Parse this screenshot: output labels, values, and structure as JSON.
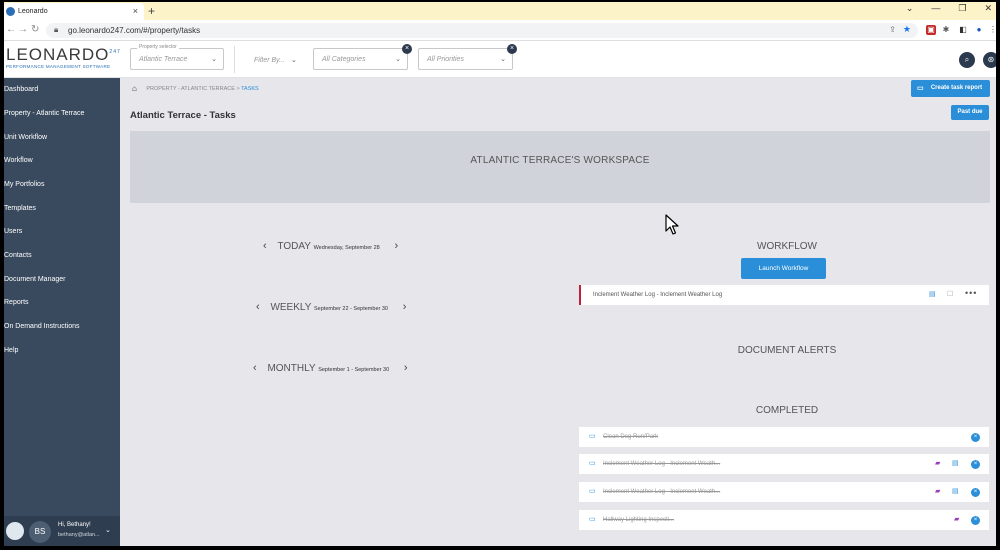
{
  "browser": {
    "tab_title": "Leonardo",
    "tab_close": "×",
    "new_tab": "+",
    "url": "go.leonardo247.com/#/property/tasks",
    "window_controls": [
      "⌄",
      "—",
      "❐",
      "✕"
    ]
  },
  "header": {
    "logo_text": "LEONARDO",
    "logo_badge": "247",
    "logo_tagline": "PERFORMANCE MANAGEMENT SOFTWARE",
    "property_selector_label": "Property selector",
    "property_selector_value": "Atlantic Terrace",
    "filter_by": "Filter By...",
    "categories_value": "All Categories",
    "priorities_value": "All Priorities"
  },
  "sidebar": {
    "items": [
      {
        "label": "Dashboard"
      },
      {
        "label": "Property - Atlantic Terrace"
      },
      {
        "label": "Unit Workflow"
      },
      {
        "label": "Workflow"
      },
      {
        "label": "My Portfolios"
      },
      {
        "label": "Templates"
      },
      {
        "label": "Users"
      },
      {
        "label": "Contacts"
      },
      {
        "label": "Document Manager"
      },
      {
        "label": "Reports"
      },
      {
        "label": "On Demand Instructions"
      },
      {
        "label": "Help"
      }
    ],
    "user": {
      "initials": "BS",
      "greeting": "Hi, Bethany!",
      "email": "bethany@atlan..."
    }
  },
  "breadcrumb": {
    "property": "PROPERTY - ATLANTIC TERRACE",
    "separator": ">",
    "current": "TASKS"
  },
  "page": {
    "title": "Atlantic Terrace - Tasks",
    "create_report_label": "Create task report",
    "past_due_label": "Past due",
    "workspace_title": "ATLANTIC TERRACE'S WORKSPACE"
  },
  "periods": {
    "today": {
      "label": "TODAY",
      "date": "Wednesday, September 28"
    },
    "weekly": {
      "label": "WEEKLY",
      "date": "September 22 - September 30"
    },
    "monthly": {
      "label": "MONTHLY",
      "date": "September 1 - September 30"
    }
  },
  "workflow": {
    "heading": "WORKFLOW",
    "launch_label": "Launch Workflow",
    "items": [
      {
        "title": "Inclement Weather Log - Inclement Weather Log"
      }
    ]
  },
  "document_alerts": {
    "heading": "DOCUMENT ALERTS"
  },
  "completed": {
    "heading": "COMPLETED",
    "items": [
      {
        "title": "Clean Dog Run/Park"
      },
      {
        "title": "Inclement Weather Log - Inclement Weath..."
      },
      {
        "title": "Inclement Weather Log - Inclement Weath..."
      },
      {
        "title": "Hallway Lighting Inspecti..."
      }
    ]
  },
  "icons": {
    "home": "home-icon",
    "accent_color": "#2a8fd8",
    "sidebar_color": "#394a5e",
    "workflow_flag_color": "#c0203a"
  }
}
